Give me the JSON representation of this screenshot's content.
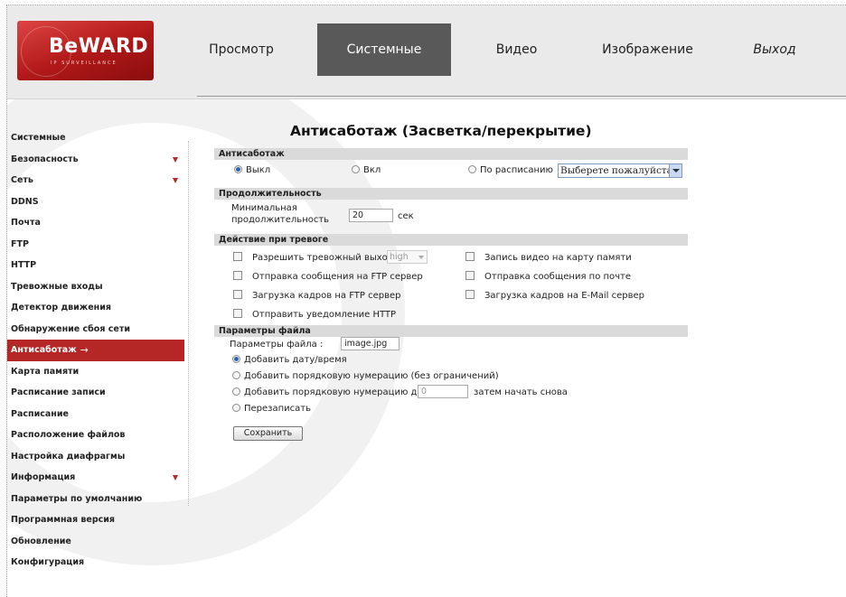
{
  "logo": {
    "brand": "BeWARD",
    "sub": "IP SURVEILLANCE"
  },
  "nav": [
    {
      "label": "Просмотр",
      "active": false
    },
    {
      "label": "Системные",
      "active": true
    },
    {
      "label": "Видео",
      "active": false
    },
    {
      "label": "Изображение",
      "active": false
    },
    {
      "label": "Выход",
      "active": false
    }
  ],
  "sidebar": [
    {
      "label": "Системные"
    },
    {
      "label": "Безопасность",
      "arrow": true
    },
    {
      "label": "Сеть",
      "arrow": true
    },
    {
      "label": "DDNS"
    },
    {
      "label": "Почта"
    },
    {
      "label": "FTP"
    },
    {
      "label": "HTTP"
    },
    {
      "label": "Тревожные входы"
    },
    {
      "label": "Детектор движения"
    },
    {
      "label": "Обнаружение сбоя сети"
    },
    {
      "label": "Антисаботаж",
      "active": true,
      "marker": "→"
    },
    {
      "label": "Карта памяти"
    },
    {
      "label": "Расписание записи"
    },
    {
      "label": "Расписание"
    },
    {
      "label": "Расположение файлов"
    },
    {
      "label": "Настройка диафрагмы"
    },
    {
      "label": "Информация",
      "arrow": true
    },
    {
      "label": "Параметры по умолчанию"
    },
    {
      "label": "Программная версия"
    },
    {
      "label": "Обновление"
    },
    {
      "label": "Конфигурация"
    }
  ],
  "page_title": "Антисаботаж (Засветка/перекрытие)",
  "antisabotage": {
    "header": "Антисаботаж",
    "off": "Выкл",
    "on": "Вкл",
    "schedule": "По расписанию",
    "schedule_select": "Выберете пожалуйста...",
    "selected": "off"
  },
  "duration": {
    "header": "Продолжительность",
    "label_line1": "Минимальная",
    "label_line2": "продолжительность",
    "value": "20",
    "unit": "сек"
  },
  "alarm_action": {
    "header": "Действие при тревоге",
    "alarm_output": "Разрешить тревожный выход",
    "alarm_output_level": "high",
    "sd_record": "Запись видео на карту памяти",
    "ftp_message": "Отправка сообщения на FTP сервер",
    "mail_message": "Отправка сообщения по почте",
    "ftp_upload": "Загрузка кадров на FTP сервер",
    "email_upload": "Загрузка кадров на E-Mail сервер",
    "http_notify": "Отправить уведомление HTTP"
  },
  "file_params": {
    "header": "Параметры файла",
    "label": "Параметры файла :",
    "filename": "image.jpg",
    "opt_datetime": "Добавить дату/время",
    "opt_sequence_unlimited": "Добавить порядковую нумерацию (без ограничений)",
    "opt_sequence_upto": "Добавить порядковую нумерацию до",
    "sequence_placeholder": "0",
    "opt_sequence_suffix": "затем начать снова",
    "opt_overwrite": "Перезаписать",
    "selected": "datetime"
  },
  "save_button": "Сохранить",
  "colors": {
    "accent": "#b52626",
    "nav_active": "#595959",
    "header_bg": "#eaeaea",
    "section_bg": "#dadada"
  }
}
